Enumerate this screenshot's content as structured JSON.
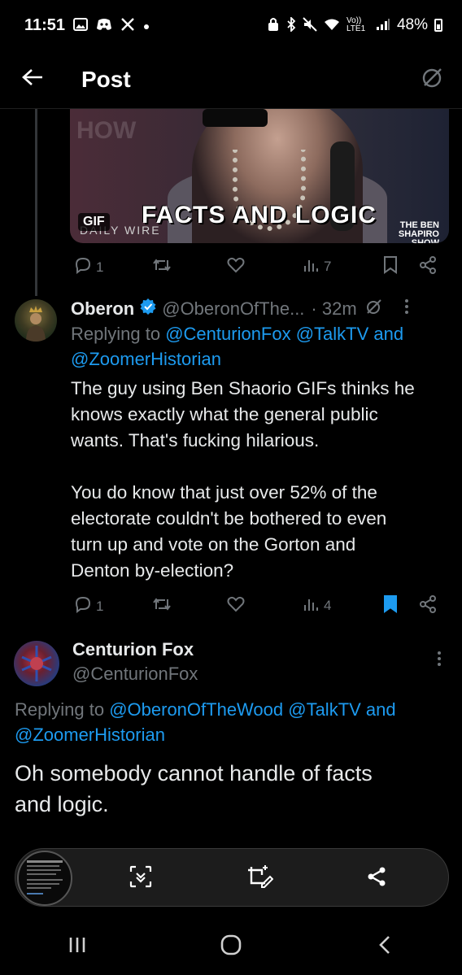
{
  "status_bar": {
    "time": "11:51",
    "network": "Vo)) LTE1",
    "battery": "48%"
  },
  "header": {
    "title": "Post"
  },
  "gif_card": {
    "badge": "GIF",
    "caption": "FACTS AND LOGIC",
    "watermark": "DAILY WIRE",
    "show_label": "THE BEN SHAPIRO SHOW",
    "bg_text": "HOW"
  },
  "post1_actions": {
    "replies": "1",
    "views": "7"
  },
  "tweet_oberon": {
    "name": "Oberon",
    "handle": "@OberonOfThe...",
    "time": "· 32m",
    "replying_prefix": "Replying to",
    "replying_handles": "@CenturionFox @TalkTV and",
    "replying_handles_2": "@ZoomerHistorian",
    "body_lines": [
      "The guy using Ben Shaorio GIFs thinks he",
      "knows exactly what the general public",
      "wants. That's fucking hilarious.",
      "",
      "You do know that just over 52% of the",
      "electorate couldn't be bothered to even",
      "turn up and vote on the Gorton and",
      "Denton by-election?"
    ],
    "replies": "1",
    "views": "4",
    "verified_color": "#1d9bf0"
  },
  "tweet_centurion": {
    "name": "Centurion Fox",
    "handle": "@CenturionFox",
    "replying_prefix": "Replying to",
    "replying_handles": "@OberonOfTheWood @TalkTV and",
    "replying_handles_2": "@ZoomerHistorian",
    "body_lines": [
      "Oh somebody cannot handle of facts",
      "and logic."
    ]
  },
  "colors": {
    "accent": "#1d9bf0",
    "muted": "#71767b",
    "text": "#e7e9ea",
    "background": "#000000"
  },
  "icons": {
    "back": "arrow-left-icon",
    "grok": "slash-circle-icon",
    "reply": "speech-bubble-icon",
    "retweet": "retweet-icon",
    "like": "heart-icon",
    "views": "bar-chart-icon",
    "bookmark": "bookmark-icon",
    "share": "share-icon",
    "more": "more-vertical-icon"
  }
}
